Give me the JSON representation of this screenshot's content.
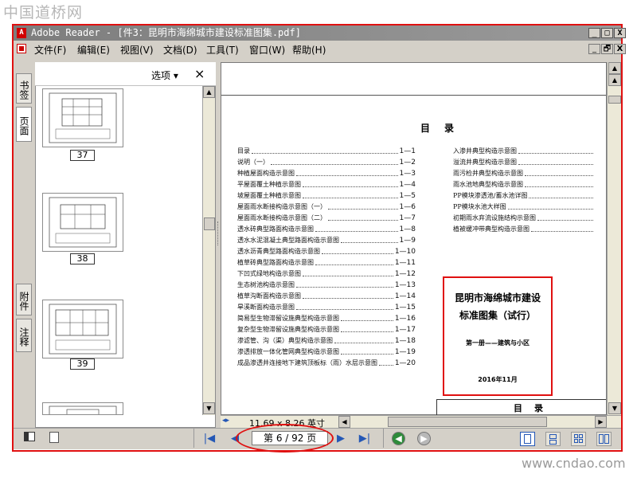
{
  "watermark": {
    "top": "中国道桥网",
    "bottom": "www.cndao.com"
  },
  "window": {
    "title": "Adobe Reader - [件3：昆明市海绵城市建设标准图集.pdf]",
    "app_icon_label": "A",
    "controls": [
      "_",
      "□",
      "X"
    ],
    "mdi_controls": [
      "_",
      "🗗",
      "X"
    ]
  },
  "menu": {
    "items": [
      "文件(F)",
      "编辑(E)",
      "视图(V)",
      "文档(D)",
      "工具(T)",
      "窗口(W)",
      "帮助(H)"
    ]
  },
  "left_tabs": {
    "top": [
      "书签",
      "页面"
    ],
    "bottom": [
      "附件",
      "注释"
    ]
  },
  "panel": {
    "options_label": "选项 ▾",
    "close_label": "×",
    "thumbnails": [
      {
        "label": "37"
      },
      {
        "label": "38"
      },
      {
        "label": "39"
      },
      {
        "label": ""
      }
    ]
  },
  "document": {
    "toc_heading": "目　录",
    "toc_left": [
      {
        "title": "目录",
        "page": "1—1"
      },
      {
        "title": "说明（一）",
        "page": "1—2"
      },
      {
        "title": "种植屋面构造示意图",
        "page": "1—3"
      },
      {
        "title": "平屋面覆土种植示意图",
        "page": "1—4"
      },
      {
        "title": "坡屋面覆土种植示意图",
        "page": "1—5"
      },
      {
        "title": "屋面雨水断接构造示意图（一）",
        "page": "1—6"
      },
      {
        "title": "屋面雨水断接构造示意图（二）",
        "page": "1—7"
      },
      {
        "title": "透水砖典型路面构造示意图",
        "page": "1—8"
      },
      {
        "title": "透水水泥混凝土典型路面构造示意图",
        "page": "1—9"
      },
      {
        "title": "透水沥青典型路面构造示意图",
        "page": "1—10"
      },
      {
        "title": "植草砖典型路面构造示意图",
        "page": "1—11"
      },
      {
        "title": "下凹式绿地构造示意图",
        "page": "1—12"
      },
      {
        "title": "生态树池构造示意图",
        "page": "1—13"
      },
      {
        "title": "植草沟断面构造示意图",
        "page": "1—14"
      },
      {
        "title": "旱溪断面构造示意图",
        "page": "1—15"
      },
      {
        "title": "简易型生物滞留设施典型构造示意图",
        "page": "1—16"
      },
      {
        "title": "复杂型生物滞留设施典型构造示意图",
        "page": "1—17"
      },
      {
        "title": "渗滤管、沟（渠）典型构造示意图",
        "page": "1—18"
      },
      {
        "title": "渗透排放一体化管网典型构造示意图",
        "page": "1—19"
      },
      {
        "title": "成品渗透井连接地下建筑顶板标（雨）水层示意图",
        "page": "1—20"
      }
    ],
    "toc_right": [
      {
        "title": "入渗井典型构造示意图"
      },
      {
        "title": "溢流井典型构造示意图"
      },
      {
        "title": "雨污检井典型构造示意图"
      },
      {
        "title": "雨水池地典型构造示意图"
      },
      {
        "title": "PP模块渗透池/蓄水池详图"
      },
      {
        "title": "PP模块水池大样图"
      },
      {
        "title": "初期雨水弃流设施结构示意图"
      },
      {
        "title": "植被缓冲带典型构造示意图"
      }
    ],
    "stamp": {
      "line1": "昆明市海绵城市建设",
      "line2": "标准图集（试行）",
      "volume": "第一册——建筑与小区",
      "date": "2016年11月"
    },
    "next_page_heading": "目　录",
    "page_size": "11.69 x 8.26 英寸"
  },
  "status": {
    "page_field": "第 6 / 92 页",
    "first": "|◀",
    "prev": "◀",
    "next": "▶",
    "last": "▶|",
    "back": "◀",
    "forward": "▶"
  },
  "colors": {
    "annotation_red": "#e01010",
    "nav_blue": "#2457b5",
    "back_green": "#2e8b3a"
  }
}
